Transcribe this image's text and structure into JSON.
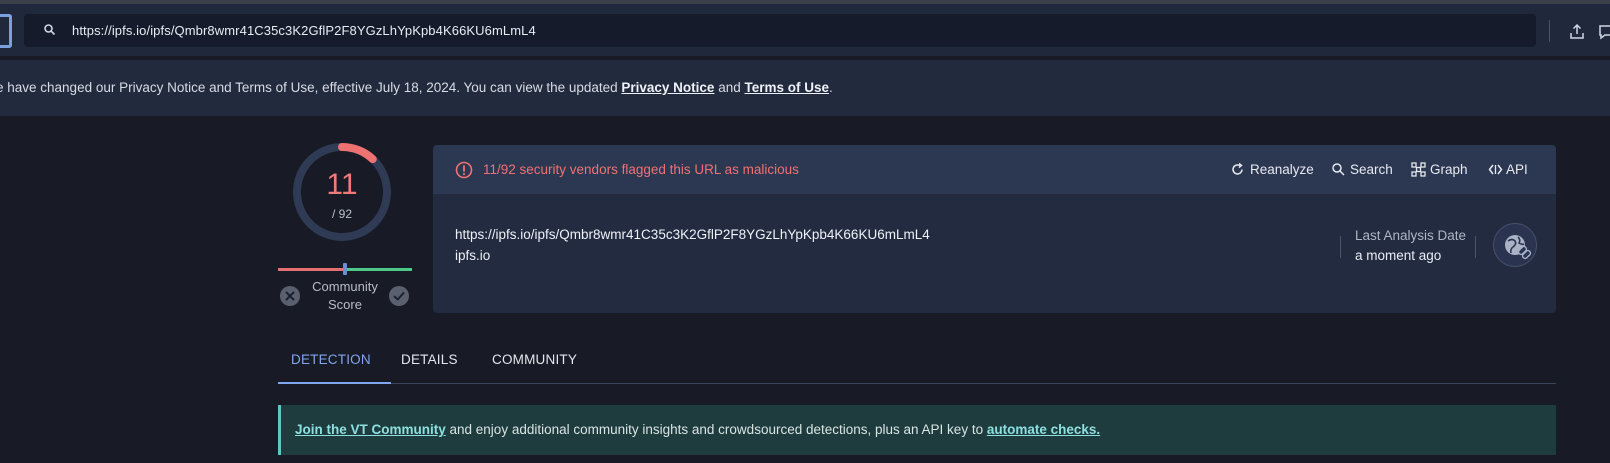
{
  "browser": {
    "url": "https://ipfs.io/ipfs/Qmbr8wmr41C35c3K2GflP2F8YGzLhYpKpb4K66KU6mLmL4"
  },
  "notice": {
    "prefix": "e have changed our Privacy Notice and Terms of Use, effective July 18, 2024. You can view the updated ",
    "privacy_link": "Privacy Notice",
    "middle": " and ",
    "terms_link": "Terms of Use",
    "suffix": "."
  },
  "score": {
    "detections": "11",
    "total": "/ 92",
    "fraction": 0.1196,
    "community_label_line1": "Community",
    "community_label_line2": "Score",
    "community_score_fraction": 0.5
  },
  "card": {
    "alert": "11/92 security vendors flagged this URL as malicious",
    "actions": {
      "reanalyze": "Reanalyze",
      "search": "Search",
      "graph": "Graph",
      "api": "API"
    },
    "url": "https://ipfs.io/ipfs/Qmbr8wmr41C35c3K2GflP2F8YGzLhYpKpb4K66KU6mLmL4",
    "domain": "ipfs.io",
    "last_analysis_label": "Last Analysis Date",
    "last_analysis_value": "a moment ago"
  },
  "tabs": {
    "detection": "DETECTION",
    "details": "DETAILS",
    "community": "COMMUNITY"
  },
  "banner": {
    "join_link": "Join the VT Community",
    "middle": " and enjoy additional community insights and crowdsourced detections, plus an API key to ",
    "automate_link": "automate checks."
  },
  "colors": {
    "malicious": "#ef7272",
    "accent": "#7fa6ee",
    "banner_accent": "#5fc6c6"
  }
}
